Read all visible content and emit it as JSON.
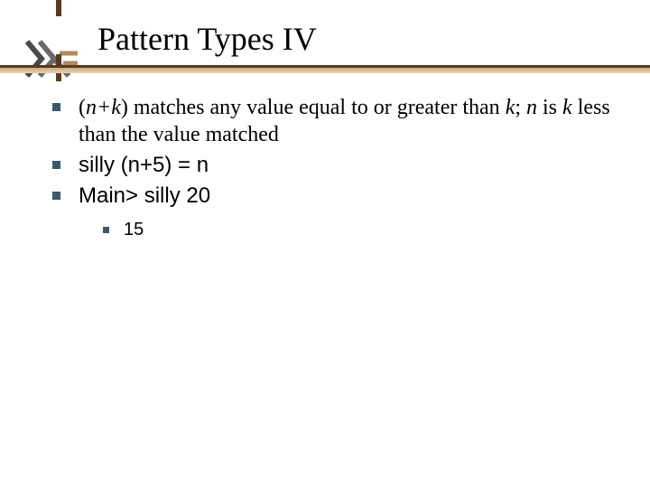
{
  "title": "Pattern Types IV",
  "items": [
    {
      "pre": "(",
      "n": "n",
      "plus": "+",
      "k": "k",
      "post": ")",
      "mid1": " matches any value equal to or greater than ",
      "k2": "k",
      "semi": "; ",
      "n2": "n",
      "mid2": " is ",
      "k3": "k",
      "tail": " less than the value matched"
    },
    {
      "text": "silly (n+5) = n"
    },
    {
      "text": "Main> silly 20"
    }
  ],
  "subitem": {
    "text": "15"
  }
}
